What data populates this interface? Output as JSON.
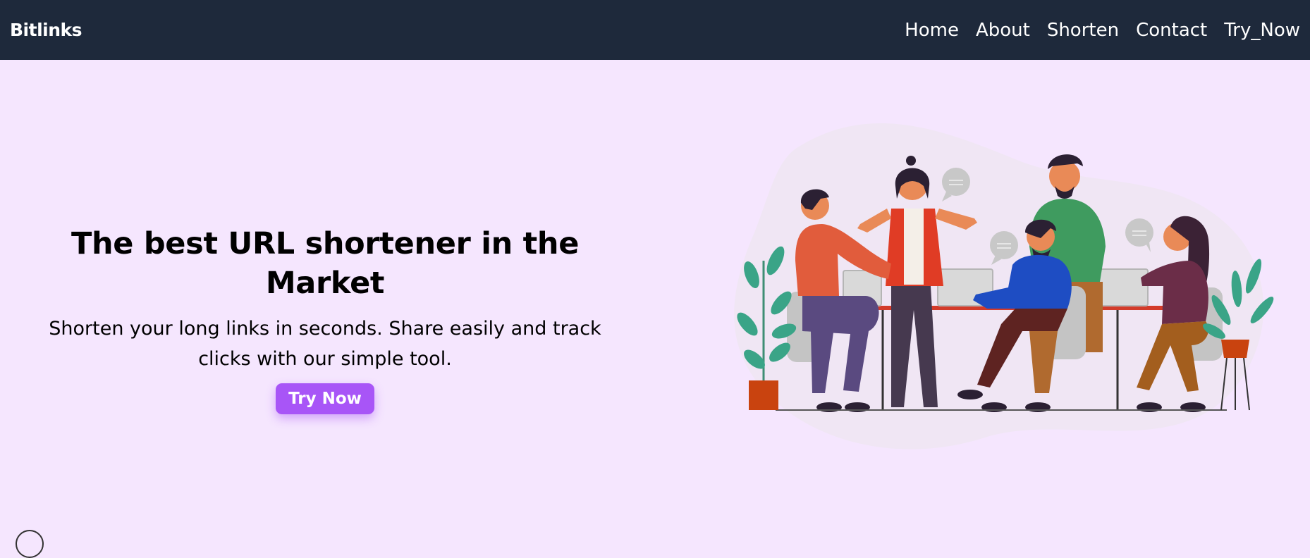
{
  "navbar": {
    "brand": "Bitlinks",
    "links": [
      "Home",
      "About",
      "Shorten",
      "Contact",
      "Try_Now"
    ]
  },
  "hero": {
    "title": "The best URL shortener in the Market",
    "subtitle": "Shorten your long links in seconds. Share easily and track clicks with our simple tool.",
    "cta_label": "Try Now"
  },
  "colors": {
    "navbar_bg": "#1e293b",
    "page_bg": "#f5e6fe",
    "cta_bg": "#a855f7"
  }
}
